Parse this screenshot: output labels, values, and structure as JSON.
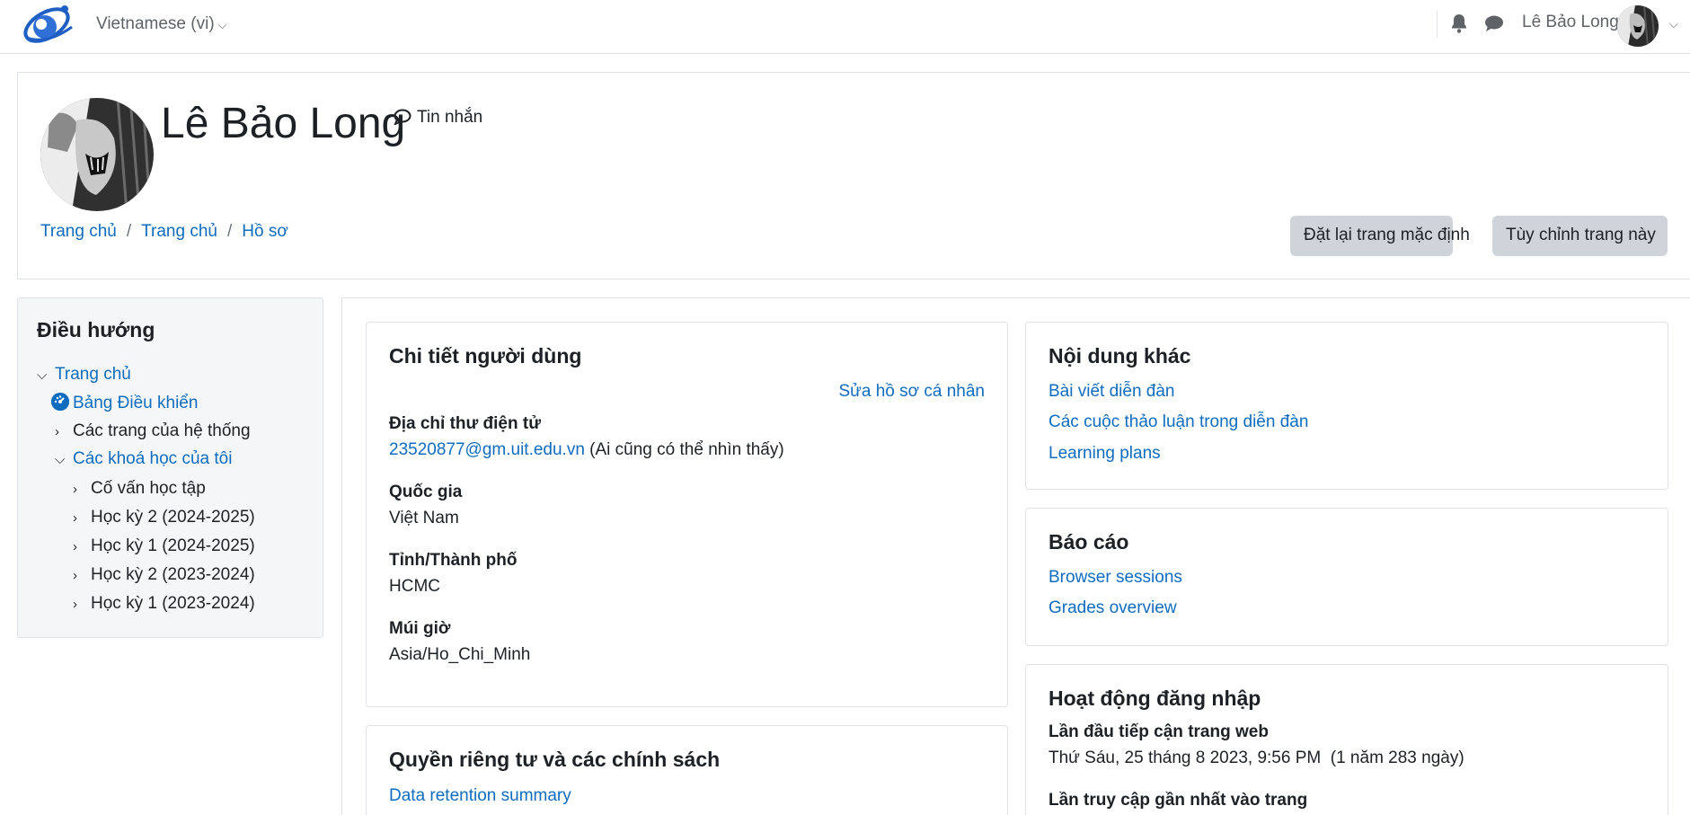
{
  "navbar": {
    "language": "Vietnamese (vi)",
    "user_name": "Lê Bảo Long",
    "icons": [
      "logo",
      "bell-icon",
      "chat-icon",
      "chevron-down-icon"
    ]
  },
  "header": {
    "title": "Lê Bảo Long",
    "message_label": "Tin nhắn",
    "breadcrumb": [
      "Trang chủ",
      "Trang chủ",
      "Hồ sơ"
    ],
    "breadcrumb_sep": "/",
    "reset_button": "Đặt lại trang mặc định",
    "customise_button": "Tùy chỉnh trang này"
  },
  "navigation": {
    "title": "Điều hướng",
    "home": "Trang chủ",
    "dashboard": "Bảng Điều khiển",
    "site_pages": "Các trang của hệ thống",
    "my_courses": "Các khoá học của tôi",
    "courses": [
      "Cố vấn học tập",
      "Học kỳ 2 (2024-2025)",
      "Học kỳ 1 (2024-2025)",
      "Học kỳ 2 (2023-2024)",
      "Học kỳ 1 (2023-2024)"
    ]
  },
  "user_details": {
    "title": "Chi tiết người dùng",
    "edit_link": "Sửa hồ sơ cá nhân",
    "email_label": "Địa chỉ thư điện tử",
    "email_value": "23520877@gm.uit.edu.vn",
    "email_note": "(Ai cũng có thể nhìn thấy)",
    "country_label": "Quốc gia",
    "country_value": "Việt Nam",
    "city_label": "Tỉnh/Thành phố",
    "city_value": "HCMC",
    "timezone_label": "Múi giờ",
    "timezone_value": "Asia/Ho_Chi_Minh"
  },
  "privacy": {
    "title": "Quyền riêng tư và các chính sách",
    "link": "Data retention summary"
  },
  "misc": {
    "title": "Nội dung khác",
    "links": [
      "Bài viết diễn đàn",
      "Các cuộc thảo luận trong diễn đàn",
      "Learning plans"
    ]
  },
  "reports": {
    "title": "Báo cáo",
    "links": [
      "Browser sessions",
      "Grades overview"
    ]
  },
  "login_activity": {
    "title": "Hoạt động đăng nhập",
    "first_access_label": "Lần đầu tiếp cận trang web",
    "first_access_value": "Thứ Sáu, 25 tháng 8 2023, 9:56 PM  (1 năm 283 ngày)",
    "last_access_label": "Lần truy cập gần nhất vào trang"
  },
  "colors": {
    "link": "#0f6cbf",
    "button_bg": "#ced4da",
    "border": "#dee2e6",
    "nav_block_bg": "#f5f6f7"
  }
}
